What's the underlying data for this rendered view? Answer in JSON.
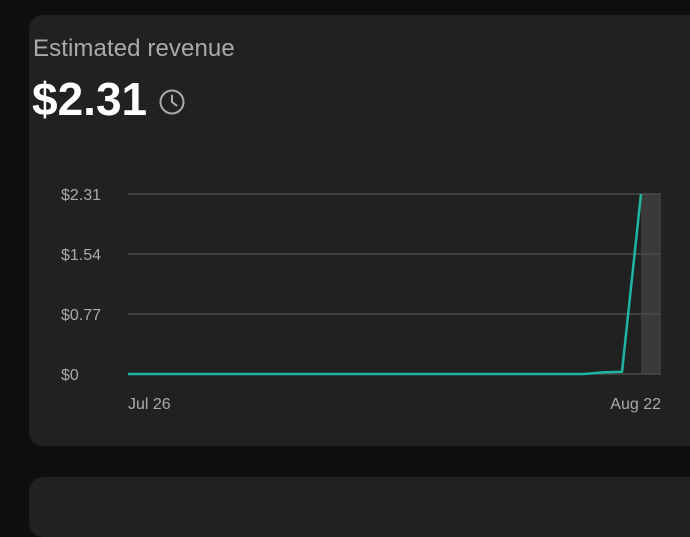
{
  "card": {
    "title": "Estimated revenue",
    "value": "$2.31",
    "info_icon": "clock-icon"
  },
  "colors": {
    "background": "#0f0f0f",
    "card": "#212121",
    "line": "#1fb5a4",
    "grid": "#4a4a4a",
    "highlight": "#3a3a3a"
  },
  "chart_data": {
    "type": "line",
    "title": "",
    "xlabel": "",
    "ylabel": "",
    "x_tick_labels": [
      "Jul 26",
      "Aug 22"
    ],
    "y_tick_labels": [
      "$2.31",
      "$1.54",
      "$0.77",
      "$0"
    ],
    "y_ticks": [
      2.31,
      1.54,
      0.77,
      0
    ],
    "ylim": [
      0,
      2.31
    ],
    "grid": true,
    "x": [
      "Jul 26",
      "Jul 27",
      "Jul 28",
      "Jul 29",
      "Jul 30",
      "Jul 31",
      "Aug 1",
      "Aug 2",
      "Aug 3",
      "Aug 4",
      "Aug 5",
      "Aug 6",
      "Aug 7",
      "Aug 8",
      "Aug 9",
      "Aug 10",
      "Aug 11",
      "Aug 12",
      "Aug 13",
      "Aug 14",
      "Aug 15",
      "Aug 16",
      "Aug 17",
      "Aug 18",
      "Aug 19",
      "Aug 20",
      "Aug 21",
      "Aug 22"
    ],
    "series": [
      {
        "values": [
          0,
          0,
          0,
          0,
          0,
          0,
          0,
          0,
          0,
          0,
          0,
          0,
          0,
          0,
          0,
          0,
          0,
          0,
          0,
          0,
          0,
          0,
          0,
          0,
          0,
          0.02,
          0.03,
          2.31
        ]
      }
    ],
    "highlighted_point": "Aug 22"
  }
}
